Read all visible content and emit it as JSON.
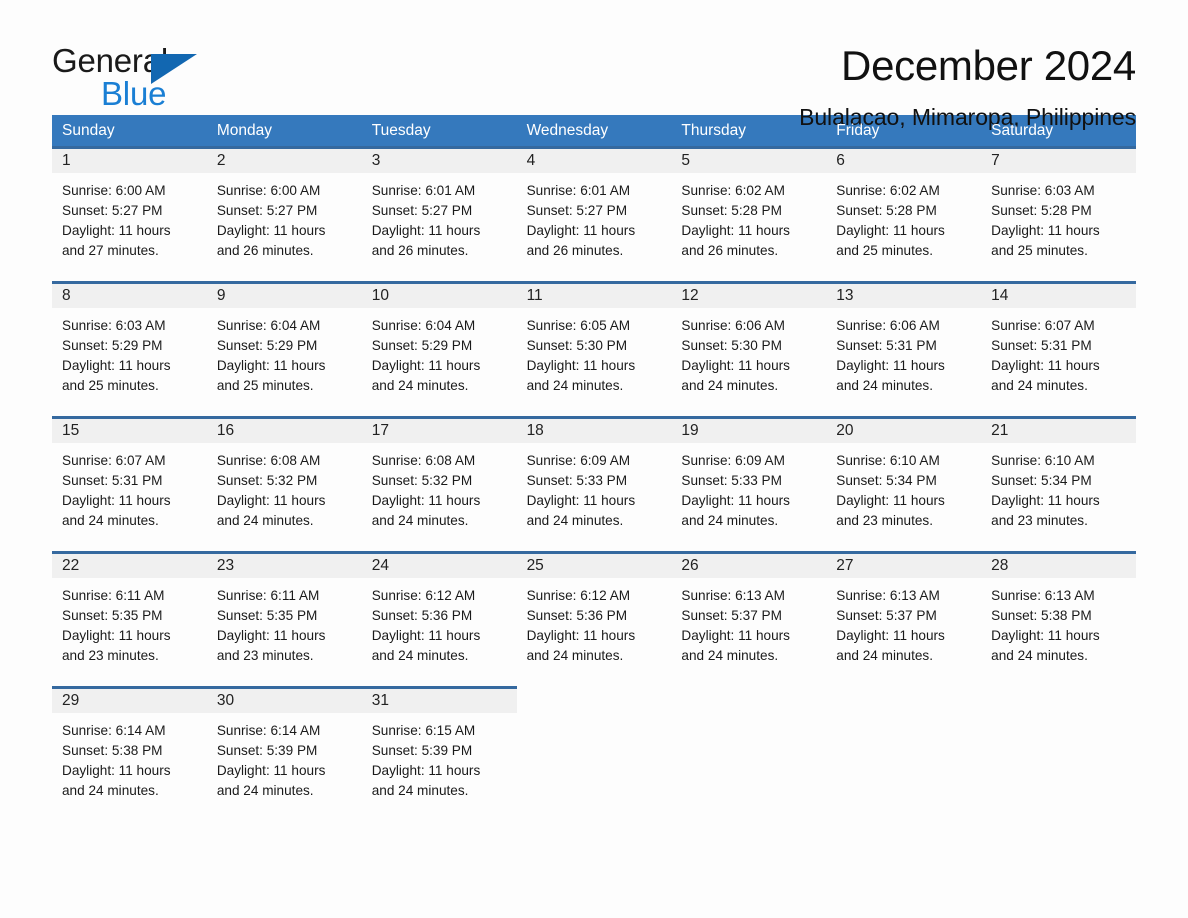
{
  "brand": {
    "name_part1": "General",
    "name_part2": "Blue"
  },
  "header": {
    "title": "December 2024",
    "subtitle": "Bulalacao, Mimaropa, Philippines"
  },
  "colors": {
    "header_blue": "#3579bd",
    "row_rule_blue": "#35699f",
    "daynum_band": "#f0f0f0",
    "logo_blue": "#1a7fd4",
    "page_bg": "#fdfdfd"
  },
  "weekdays": [
    "Sunday",
    "Monday",
    "Tuesday",
    "Wednesday",
    "Thursday",
    "Friday",
    "Saturday"
  ],
  "weeks": [
    [
      {
        "day": "1",
        "sunrise": "Sunrise: 6:00 AM",
        "sunset": "Sunset: 5:27 PM",
        "daylight_line1": "Daylight: 11 hours",
        "daylight_line2": "and 27 minutes."
      },
      {
        "day": "2",
        "sunrise": "Sunrise: 6:00 AM",
        "sunset": "Sunset: 5:27 PM",
        "daylight_line1": "Daylight: 11 hours",
        "daylight_line2": "and 26 minutes."
      },
      {
        "day": "3",
        "sunrise": "Sunrise: 6:01 AM",
        "sunset": "Sunset: 5:27 PM",
        "daylight_line1": "Daylight: 11 hours",
        "daylight_line2": "and 26 minutes."
      },
      {
        "day": "4",
        "sunrise": "Sunrise: 6:01 AM",
        "sunset": "Sunset: 5:27 PM",
        "daylight_line1": "Daylight: 11 hours",
        "daylight_line2": "and 26 minutes."
      },
      {
        "day": "5",
        "sunrise": "Sunrise: 6:02 AM",
        "sunset": "Sunset: 5:28 PM",
        "daylight_line1": "Daylight: 11 hours",
        "daylight_line2": "and 26 minutes."
      },
      {
        "day": "6",
        "sunrise": "Sunrise: 6:02 AM",
        "sunset": "Sunset: 5:28 PM",
        "daylight_line1": "Daylight: 11 hours",
        "daylight_line2": "and 25 minutes."
      },
      {
        "day": "7",
        "sunrise": "Sunrise: 6:03 AM",
        "sunset": "Sunset: 5:28 PM",
        "daylight_line1": "Daylight: 11 hours",
        "daylight_line2": "and 25 minutes."
      }
    ],
    [
      {
        "day": "8",
        "sunrise": "Sunrise: 6:03 AM",
        "sunset": "Sunset: 5:29 PM",
        "daylight_line1": "Daylight: 11 hours",
        "daylight_line2": "and 25 minutes."
      },
      {
        "day": "9",
        "sunrise": "Sunrise: 6:04 AM",
        "sunset": "Sunset: 5:29 PM",
        "daylight_line1": "Daylight: 11 hours",
        "daylight_line2": "and 25 minutes."
      },
      {
        "day": "10",
        "sunrise": "Sunrise: 6:04 AM",
        "sunset": "Sunset: 5:29 PM",
        "daylight_line1": "Daylight: 11 hours",
        "daylight_line2": "and 24 minutes."
      },
      {
        "day": "11",
        "sunrise": "Sunrise: 6:05 AM",
        "sunset": "Sunset: 5:30 PM",
        "daylight_line1": "Daylight: 11 hours",
        "daylight_line2": "and 24 minutes."
      },
      {
        "day": "12",
        "sunrise": "Sunrise: 6:06 AM",
        "sunset": "Sunset: 5:30 PM",
        "daylight_line1": "Daylight: 11 hours",
        "daylight_line2": "and 24 minutes."
      },
      {
        "day": "13",
        "sunrise": "Sunrise: 6:06 AM",
        "sunset": "Sunset: 5:31 PM",
        "daylight_line1": "Daylight: 11 hours",
        "daylight_line2": "and 24 minutes."
      },
      {
        "day": "14",
        "sunrise": "Sunrise: 6:07 AM",
        "sunset": "Sunset: 5:31 PM",
        "daylight_line1": "Daylight: 11 hours",
        "daylight_line2": "and 24 minutes."
      }
    ],
    [
      {
        "day": "15",
        "sunrise": "Sunrise: 6:07 AM",
        "sunset": "Sunset: 5:31 PM",
        "daylight_line1": "Daylight: 11 hours",
        "daylight_line2": "and 24 minutes."
      },
      {
        "day": "16",
        "sunrise": "Sunrise: 6:08 AM",
        "sunset": "Sunset: 5:32 PM",
        "daylight_line1": "Daylight: 11 hours",
        "daylight_line2": "and 24 minutes."
      },
      {
        "day": "17",
        "sunrise": "Sunrise: 6:08 AM",
        "sunset": "Sunset: 5:32 PM",
        "daylight_line1": "Daylight: 11 hours",
        "daylight_line2": "and 24 minutes."
      },
      {
        "day": "18",
        "sunrise": "Sunrise: 6:09 AM",
        "sunset": "Sunset: 5:33 PM",
        "daylight_line1": "Daylight: 11 hours",
        "daylight_line2": "and 24 minutes."
      },
      {
        "day": "19",
        "sunrise": "Sunrise: 6:09 AM",
        "sunset": "Sunset: 5:33 PM",
        "daylight_line1": "Daylight: 11 hours",
        "daylight_line2": "and 24 minutes."
      },
      {
        "day": "20",
        "sunrise": "Sunrise: 6:10 AM",
        "sunset": "Sunset: 5:34 PM",
        "daylight_line1": "Daylight: 11 hours",
        "daylight_line2": "and 23 minutes."
      },
      {
        "day": "21",
        "sunrise": "Sunrise: 6:10 AM",
        "sunset": "Sunset: 5:34 PM",
        "daylight_line1": "Daylight: 11 hours",
        "daylight_line2": "and 23 minutes."
      }
    ],
    [
      {
        "day": "22",
        "sunrise": "Sunrise: 6:11 AM",
        "sunset": "Sunset: 5:35 PM",
        "daylight_line1": "Daylight: 11 hours",
        "daylight_line2": "and 23 minutes."
      },
      {
        "day": "23",
        "sunrise": "Sunrise: 6:11 AM",
        "sunset": "Sunset: 5:35 PM",
        "daylight_line1": "Daylight: 11 hours",
        "daylight_line2": "and 23 minutes."
      },
      {
        "day": "24",
        "sunrise": "Sunrise: 6:12 AM",
        "sunset": "Sunset: 5:36 PM",
        "daylight_line1": "Daylight: 11 hours",
        "daylight_line2": "and 24 minutes."
      },
      {
        "day": "25",
        "sunrise": "Sunrise: 6:12 AM",
        "sunset": "Sunset: 5:36 PM",
        "daylight_line1": "Daylight: 11 hours",
        "daylight_line2": "and 24 minutes."
      },
      {
        "day": "26",
        "sunrise": "Sunrise: 6:13 AM",
        "sunset": "Sunset: 5:37 PM",
        "daylight_line1": "Daylight: 11 hours",
        "daylight_line2": "and 24 minutes."
      },
      {
        "day": "27",
        "sunrise": "Sunrise: 6:13 AM",
        "sunset": "Sunset: 5:37 PM",
        "daylight_line1": "Daylight: 11 hours",
        "daylight_line2": "and 24 minutes."
      },
      {
        "day": "28",
        "sunrise": "Sunrise: 6:13 AM",
        "sunset": "Sunset: 5:38 PM",
        "daylight_line1": "Daylight: 11 hours",
        "daylight_line2": "and 24 minutes."
      }
    ],
    [
      {
        "day": "29",
        "sunrise": "Sunrise: 6:14 AM",
        "sunset": "Sunset: 5:38 PM",
        "daylight_line1": "Daylight: 11 hours",
        "daylight_line2": "and 24 minutes."
      },
      {
        "day": "30",
        "sunrise": "Sunrise: 6:14 AM",
        "sunset": "Sunset: 5:39 PM",
        "daylight_line1": "Daylight: 11 hours",
        "daylight_line2": "and 24 minutes."
      },
      {
        "day": "31",
        "sunrise": "Sunrise: 6:15 AM",
        "sunset": "Sunset: 5:39 PM",
        "daylight_line1": "Daylight: 11 hours",
        "daylight_line2": "and 24 minutes."
      },
      {
        "day": "",
        "sunrise": "",
        "sunset": "",
        "daylight_line1": "",
        "daylight_line2": ""
      },
      {
        "day": "",
        "sunrise": "",
        "sunset": "",
        "daylight_line1": "",
        "daylight_line2": ""
      },
      {
        "day": "",
        "sunrise": "",
        "sunset": "",
        "daylight_line1": "",
        "daylight_line2": ""
      },
      {
        "day": "",
        "sunrise": "",
        "sunset": "",
        "daylight_line1": "",
        "daylight_line2": ""
      }
    ]
  ]
}
